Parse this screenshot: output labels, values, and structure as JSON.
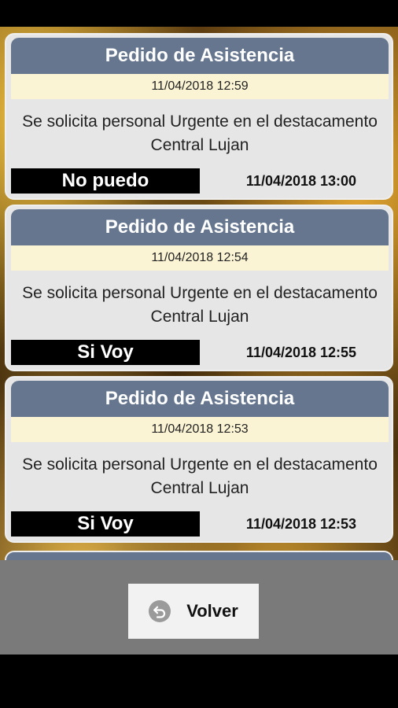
{
  "requests": [
    {
      "title": "Pedido de Asistencia",
      "date": "11/04/2018 12:59",
      "message": "Se solicita personal Urgente en el destacamento Central Lujan",
      "response": "No puedo",
      "response_time": "11/04/2018 13:00"
    },
    {
      "title": "Pedido de Asistencia",
      "date": "11/04/2018 12:54",
      "message": "Se solicita personal Urgente en el destacamento Central Lujan",
      "response": "Si Voy",
      "response_time": "11/04/2018 12:55"
    },
    {
      "title": "Pedido de Asistencia",
      "date": "11/04/2018 12:53",
      "message": "Se solicita personal Urgente en el destacamento Central Lujan",
      "response": "Si Voy",
      "response_time": "11/04/2018 12:53"
    }
  ],
  "footer": {
    "back_label": "Volver",
    "back_icon": "undo-icon"
  },
  "colors": {
    "header": "#66768f",
    "date_band": "#fbf4d4",
    "card": "#e6e6e6",
    "response_bg": "#000000"
  }
}
